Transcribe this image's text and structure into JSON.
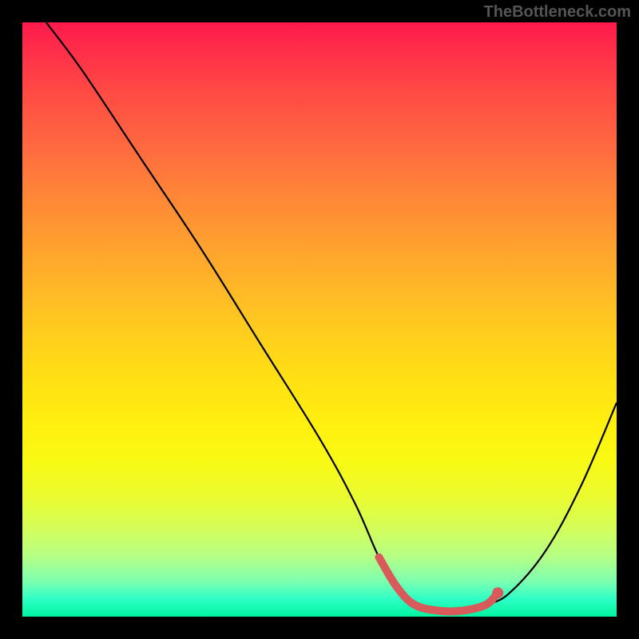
{
  "watermark": "TheBottleneck.com",
  "chart_data": {
    "type": "line",
    "title": "",
    "xlabel": "",
    "ylabel": "",
    "xlim": [
      0,
      100
    ],
    "ylim": [
      0,
      100
    ],
    "curve": {
      "x": [
        4,
        10,
        20,
        30,
        40,
        50,
        56,
        60,
        63,
        66,
        70,
        74,
        78,
        82,
        88,
        94,
        100
      ],
      "y": [
        100,
        92,
        77,
        62,
        46,
        30,
        19,
        10,
        5,
        2,
        1,
        1,
        2,
        4,
        11,
        22,
        36
      ]
    },
    "highlight_segment": {
      "x": [
        60,
        63,
        66,
        70,
        74,
        78,
        80
      ],
      "y": [
        10,
        5,
        2,
        1,
        1,
        2,
        4
      ]
    },
    "highlight_dot": {
      "x": 80,
      "y": 4
    },
    "background_gradient": {
      "top_color": "#ff1a4d",
      "mid_color": "#fff00e",
      "bottom_color": "#00f5a0"
    }
  }
}
